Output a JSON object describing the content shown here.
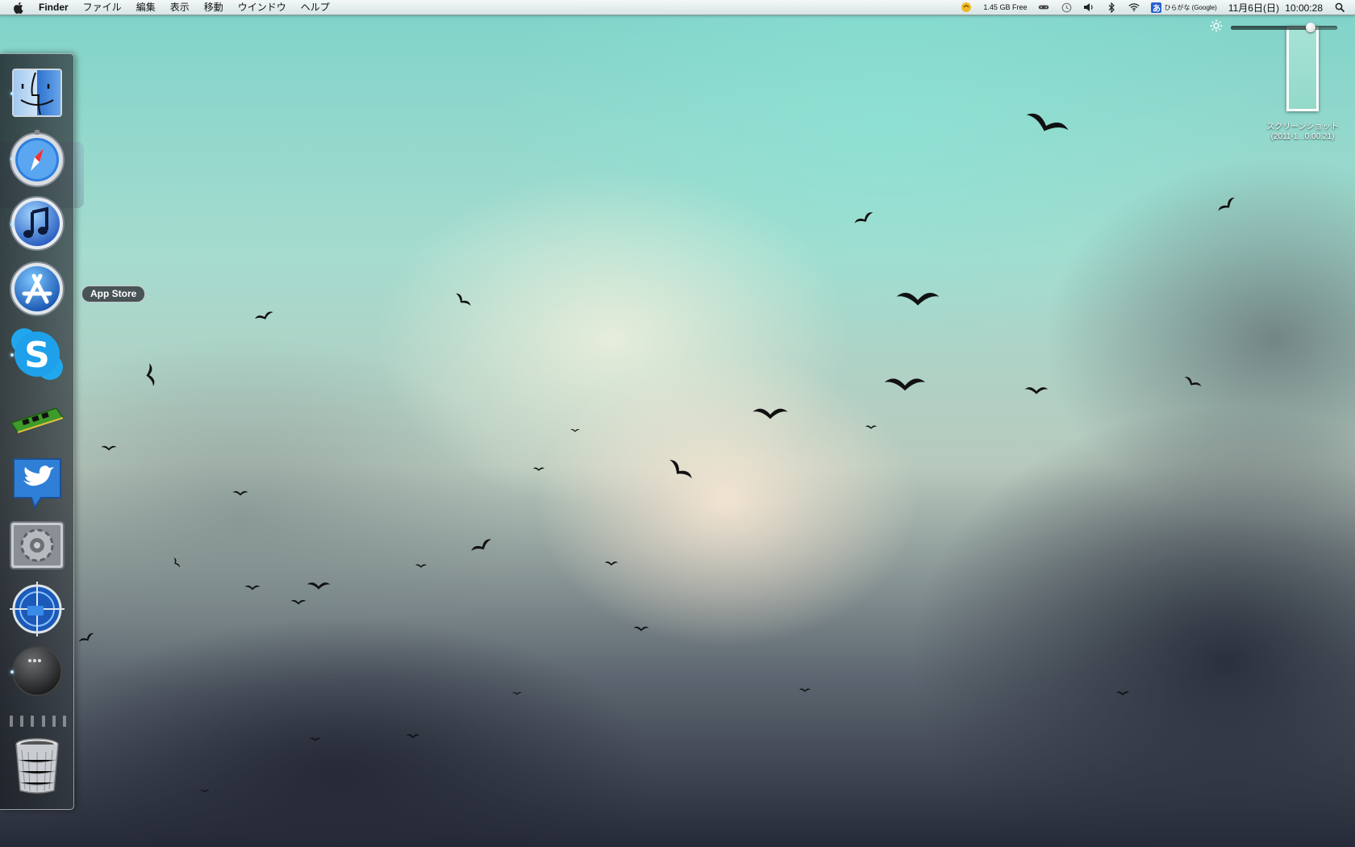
{
  "menubar": {
    "apple_icon": "apple-logo",
    "app_name": "Finder",
    "menus": [
      "ファイル",
      "編集",
      "表示",
      "移動",
      "ウインドウ",
      "ヘルプ"
    ],
    "status": {
      "disk_free": "1.45 GB Free",
      "input_method": "ひらがな (Google)",
      "input_method_icon": "あ",
      "date": "11月6日(日)",
      "time": "10:00:28",
      "icons": [
        "growl-icon",
        "gamepad-icon",
        "time-machine-icon",
        "volume-icon",
        "bluetooth-icon",
        "wifi-icon",
        "input-method-icon",
        "spotlight-icon"
      ]
    }
  },
  "dock": {
    "items": [
      {
        "name": "Finder",
        "icon": "finder-icon",
        "running": true
      },
      {
        "name": "Safari",
        "icon": "safari-icon",
        "running": true
      },
      {
        "name": "iTunes",
        "icon": "itunes-icon",
        "running": true
      },
      {
        "name": "App Store",
        "icon": "app-store-icon",
        "running": false
      },
      {
        "name": "Skype",
        "icon": "skype-icon",
        "running": true
      },
      {
        "name": "Memory",
        "icon": "memory-ram-icon",
        "running": false
      },
      {
        "name": "Twitter",
        "icon": "twitter-icon",
        "running": false
      },
      {
        "name": "System Preferences",
        "icon": "system-preferences-icon",
        "running": false
      },
      {
        "name": "Screen Sharing",
        "icon": "screen-sharing-icon",
        "running": false
      },
      {
        "name": "More",
        "icon": "more-dots-icon",
        "running": true
      },
      {
        "name": "Trash",
        "icon": "trash-icon",
        "running": false
      }
    ],
    "tooltip": "App Store"
  },
  "brightness": {
    "icon": "brightness-icon",
    "level": 0.75
  },
  "desktop": {
    "file": {
      "line1": "スクリーンショット",
      "line2": "(2011-1...0.00.21)"
    },
    "accent_colors": {
      "sky": "#7fd3c9",
      "dock_dot": "#bfe9ff"
    }
  }
}
